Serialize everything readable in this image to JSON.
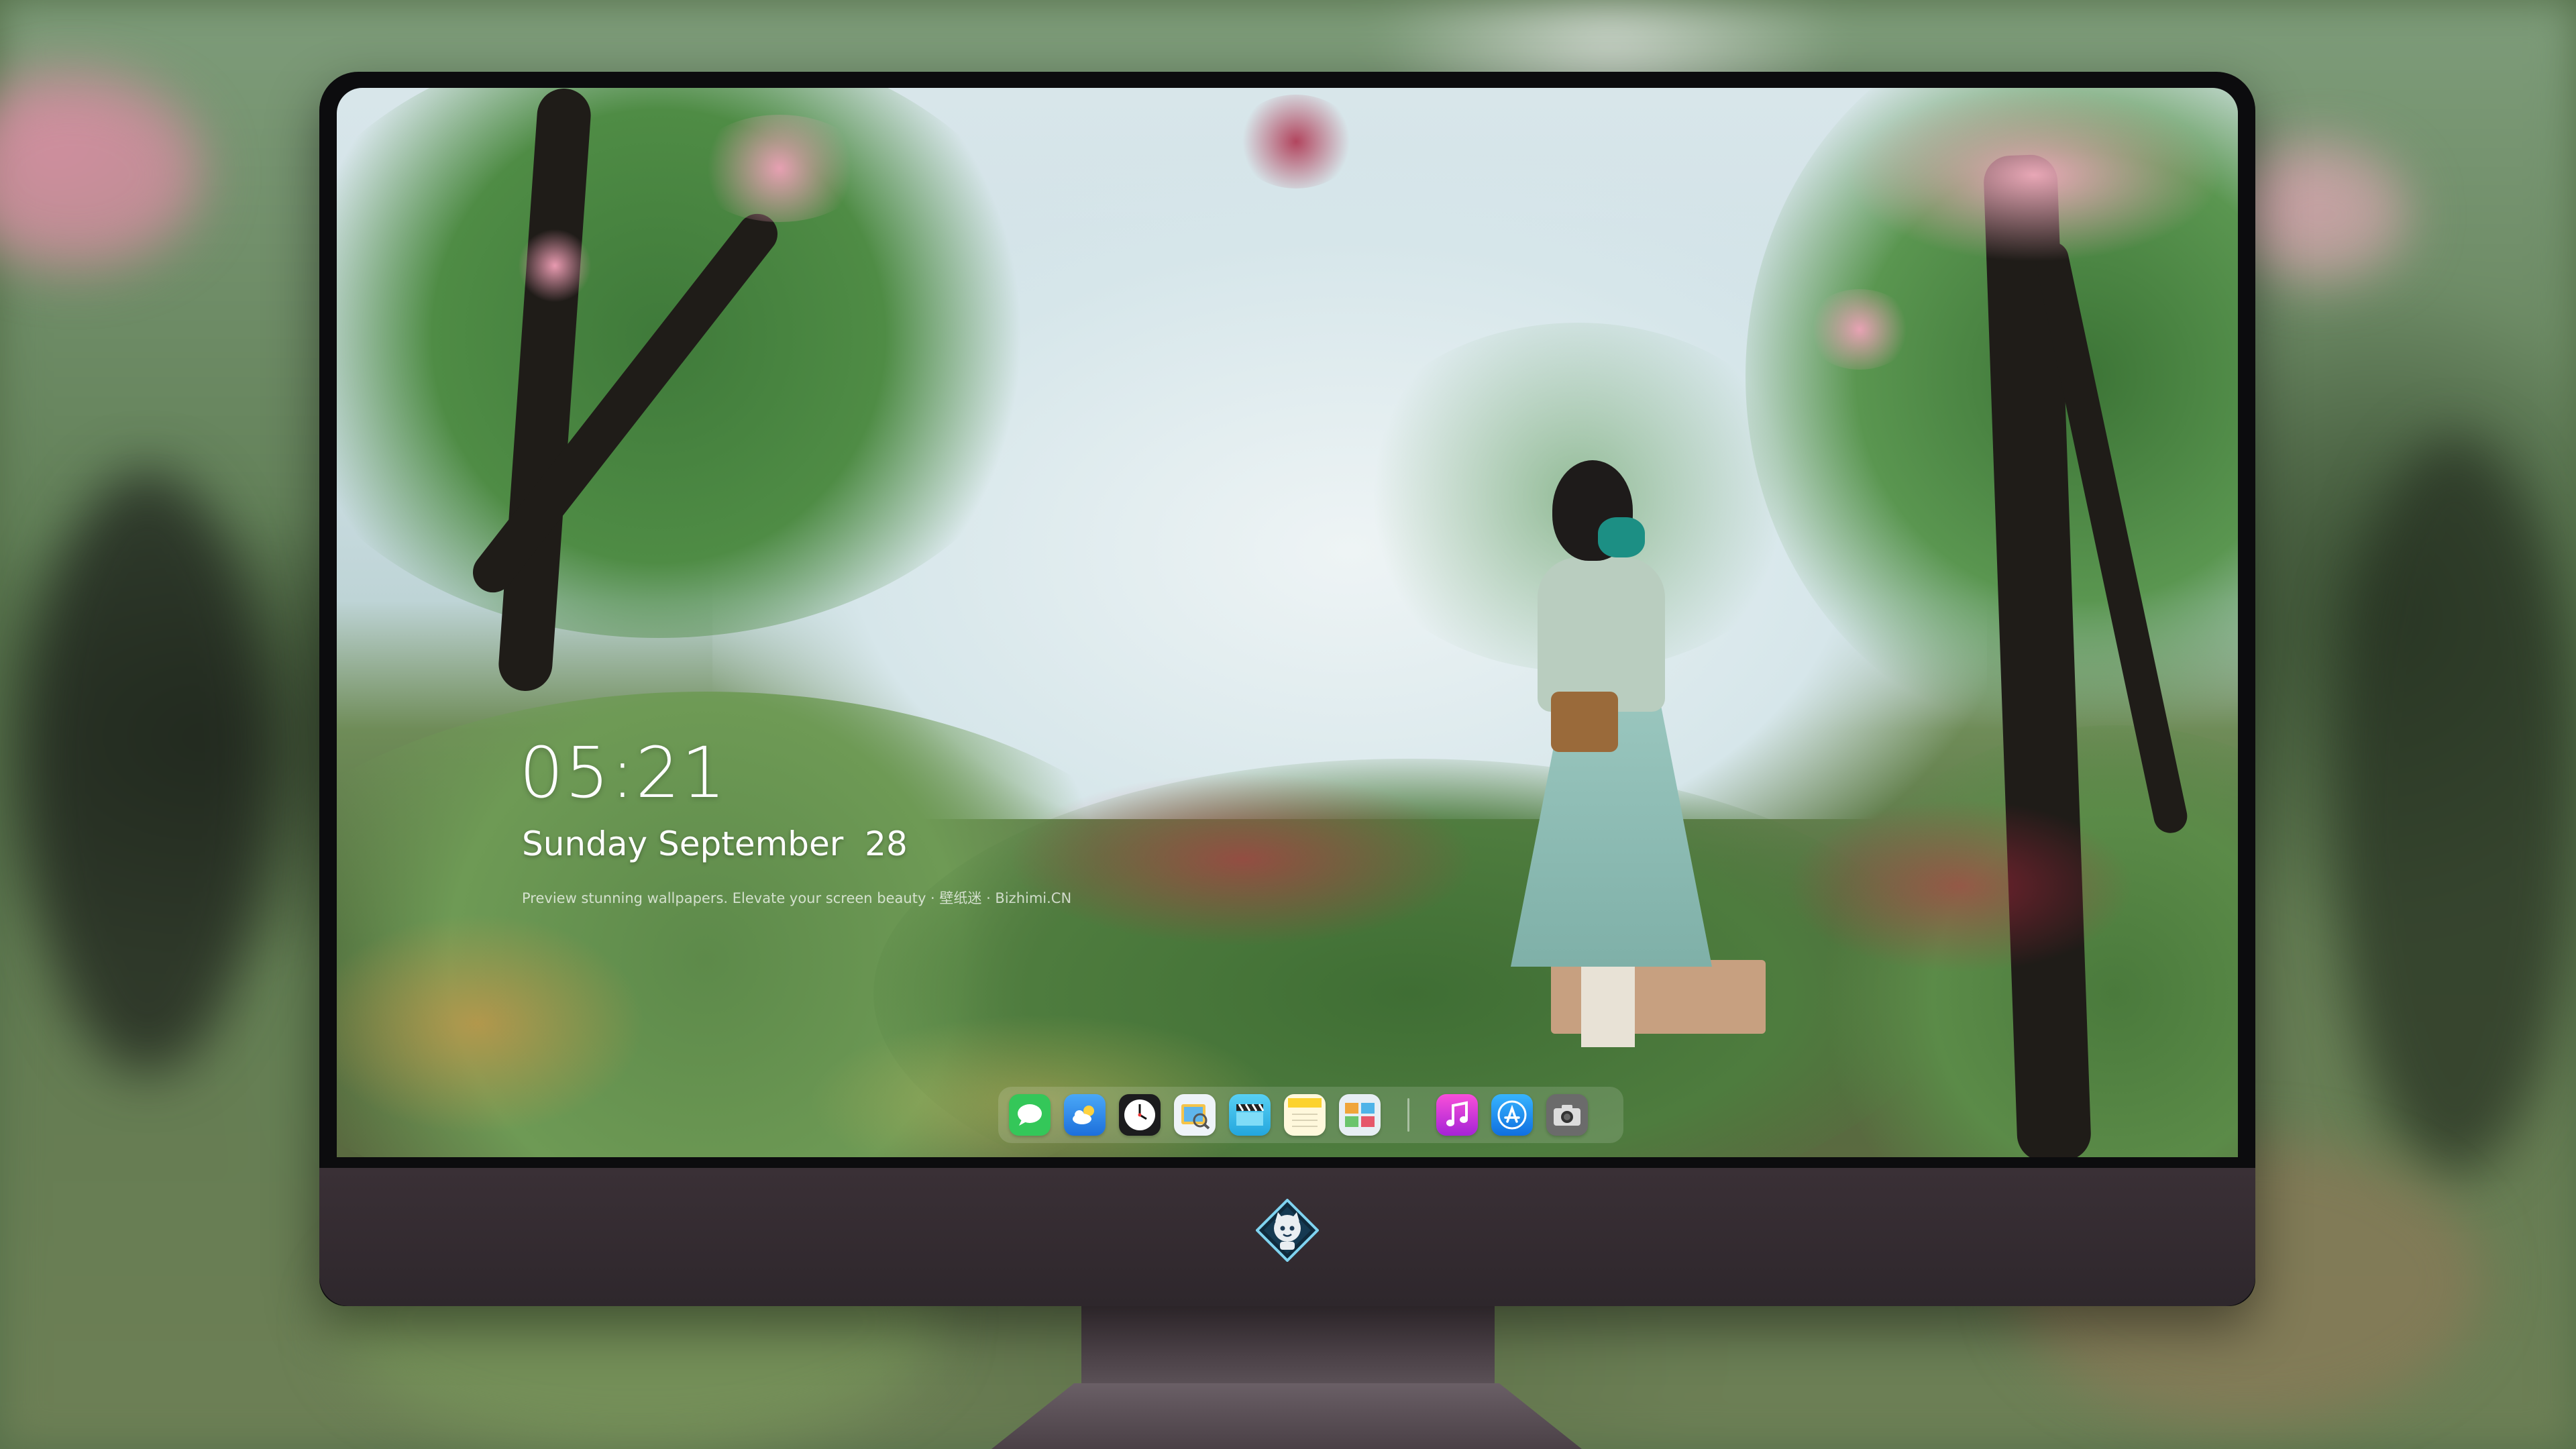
{
  "lockscreen": {
    "time": "05:21",
    "date": "Sunday September  28",
    "tagline": "Preview stunning wallpapers. Elevate your screen beauty · 壁纸迷 · Bizhimi.CN"
  },
  "dock": {
    "apps": [
      {
        "name": "messages-icon",
        "color": "#34c759"
      },
      {
        "name": "weather-icon",
        "color": "#2f8cf0"
      },
      {
        "name": "clock-icon",
        "color": "#1c1c1e"
      },
      {
        "name": "preview-icon",
        "color": "#e9f0f6"
      },
      {
        "name": "clips-icon",
        "color": "#2cb8e8"
      },
      {
        "name": "notes-icon",
        "color": "#fcd22e"
      },
      {
        "name": "photo-booth-icon",
        "color": "#e7eef4"
      },
      {
        "name": "music-icon",
        "color": "#c22ed6"
      },
      {
        "name": "app-store-icon",
        "color": "#1a8cf0"
      },
      {
        "name": "camera-icon",
        "color": "#6b6b6b"
      }
    ]
  },
  "colors": {
    "bezel": "#0c0c0e",
    "chin": "#2e272c",
    "text": "#ffffff"
  }
}
